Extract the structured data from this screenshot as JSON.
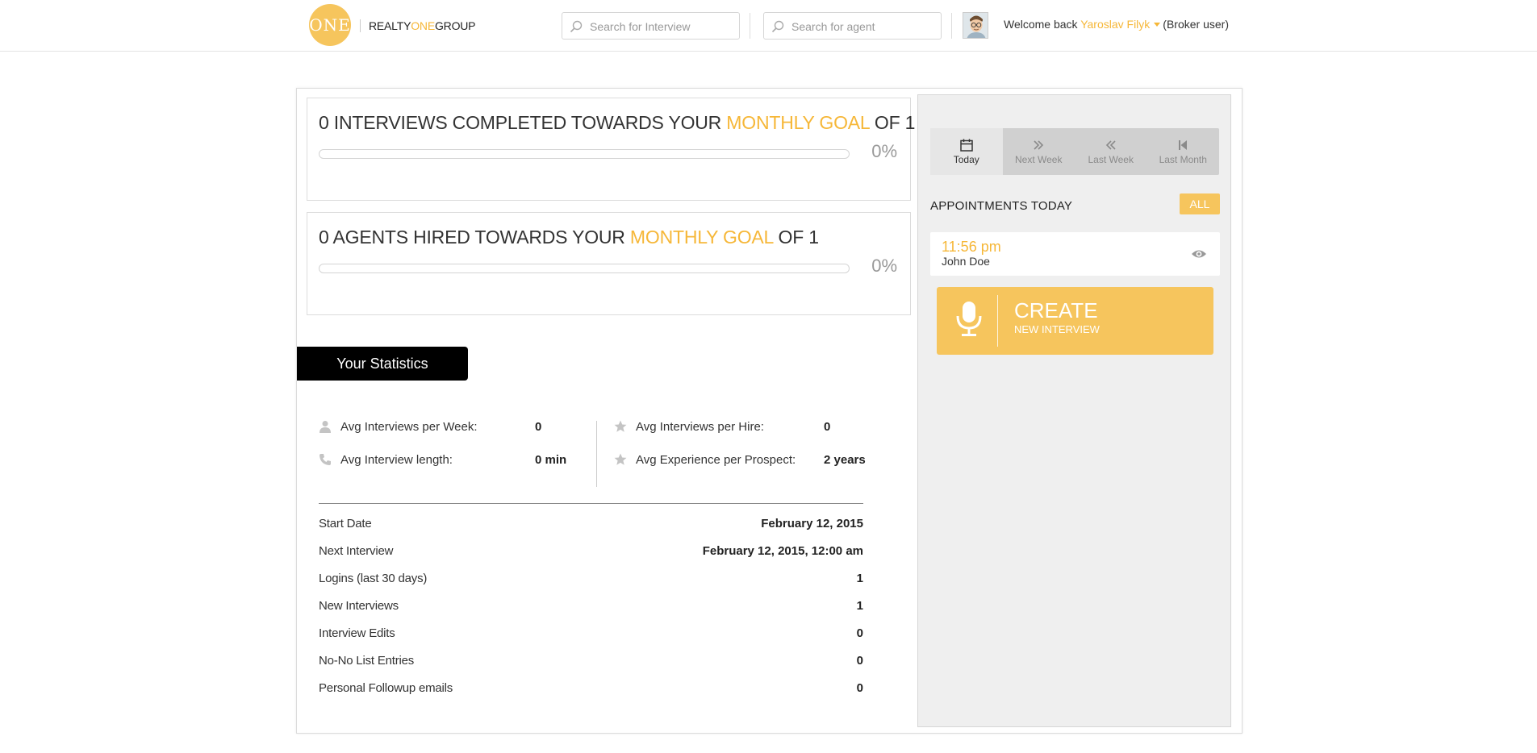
{
  "header": {
    "logo_mark": "ONE",
    "brand": {
      "part1": "REALTY",
      "part2": "ONE",
      "part3": "GROUP"
    },
    "search_interview_placeholder": "Search for Interview",
    "search_agent_placeholder": "Search for agent",
    "welcome_prefix": "Welcome back",
    "user_name": "Yaroslav Filyk",
    "user_role": "(Broker user)"
  },
  "goals": [
    {
      "count_text": "0 INTERVIEWS COMPLETED TOWARDS YOUR",
      "accent": "MONTHLY GOAL",
      "suffix": "OF 1",
      "percent_label": "0%",
      "progress": 0
    },
    {
      "count_text": "0 AGENTS HIRED TOWARDS YOUR",
      "accent": "MONTHLY GOAL",
      "suffix": "OF 1",
      "percent_label": "0%",
      "progress": 0
    }
  ],
  "statistics": {
    "tab_label": "Your Statistics",
    "averages": [
      {
        "icon": "user-icon",
        "label": "Avg Interviews per Week:",
        "value": "0"
      },
      {
        "icon": "phone-icon",
        "label": "Avg Interview length:",
        "value": "0 min"
      },
      {
        "icon": "star-icon",
        "label": "Avg Interviews per Hire:",
        "value": "0"
      },
      {
        "icon": "star-icon",
        "label": "Avg Experience per Prospect:",
        "value": "2 years"
      }
    ],
    "details": [
      {
        "label": "Start Date",
        "value": "February 12, 2015"
      },
      {
        "label": "Next Interview",
        "value": "February 12, 2015, 12:00 am"
      },
      {
        "label": "Logins (last 30 days)",
        "value": "1"
      },
      {
        "label": "New Interviews",
        "value": "1"
      },
      {
        "label": "Interview Edits",
        "value": "0"
      },
      {
        "label": "No-No List Entries",
        "value": "0"
      },
      {
        "label": "Personal Followup emails",
        "value": "0"
      }
    ]
  },
  "appointments": {
    "tabs": [
      {
        "label": "Today",
        "icon": "calendar-icon",
        "active": true
      },
      {
        "label": "Next Week",
        "icon": "double-chevron-right-icon",
        "active": false
      },
      {
        "label": "Last Week",
        "icon": "double-chevron-left-icon",
        "active": false
      },
      {
        "label": "Last Month",
        "icon": "skip-back-icon",
        "active": false
      }
    ],
    "header": "APPOINTMENTS TODAY",
    "all_label": "ALL",
    "items": [
      {
        "time": "11:56 pm",
        "name": "John Doe"
      }
    ],
    "create": {
      "title": "CREATE",
      "subtitle": "NEW INTERVIEW"
    }
  },
  "colors": {
    "accent": "#f6b738",
    "button_yellow": "#f6c55d",
    "stats_tab": "#000000",
    "panel_bg": "#efefef"
  }
}
